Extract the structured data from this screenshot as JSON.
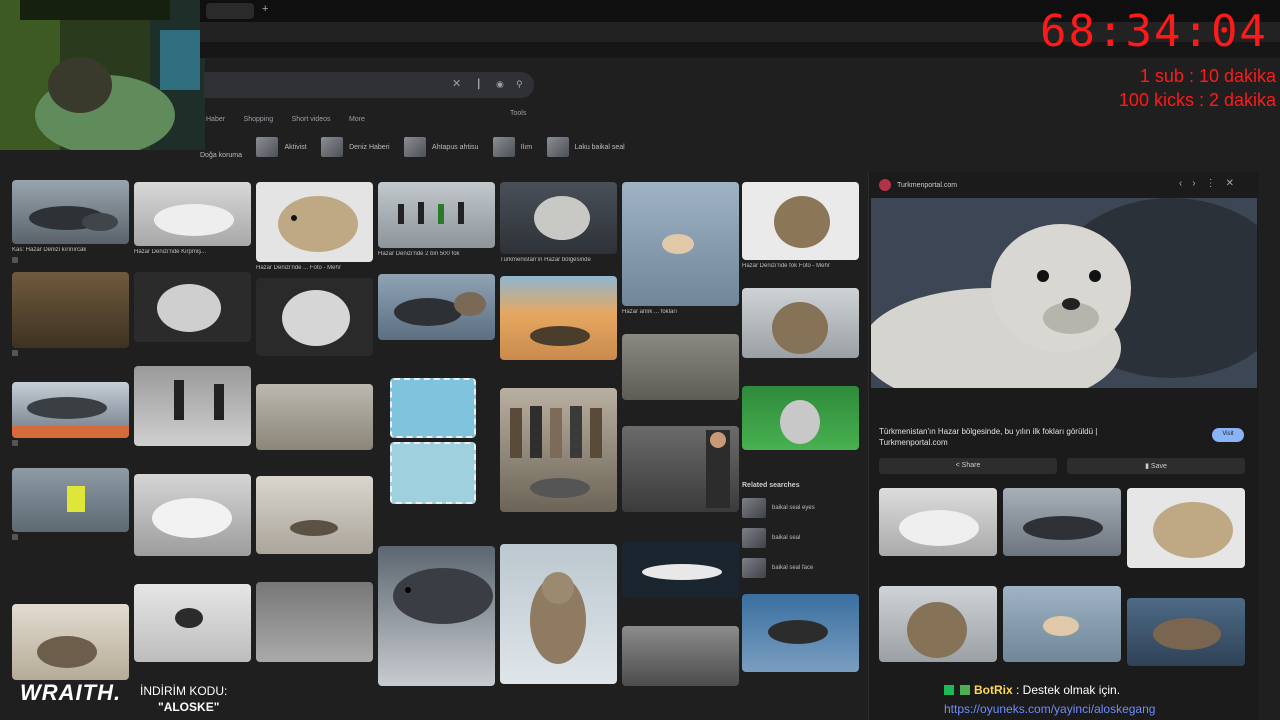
{
  "browser": {
    "tab_label": "",
    "new_tab": "+"
  },
  "search": {
    "clear_icon": "close-icon",
    "filters": [
      "Haber",
      "Shopping",
      "Short videos",
      "More"
    ],
    "tools_label": "Tools"
  },
  "chips": [
    "Doğa koruma",
    "Aktivist",
    "Deniz Haberi",
    "Ahtapus ahtisu",
    "Ilım",
    "Laku baikal seal"
  ],
  "results": [
    {
      "cap": "Kas: Hazar Denizi kırınırcak",
      "src": ""
    },
    {
      "cap": "Hazar Denizi'nde Kirpmiş...",
      "src": ""
    },
    {
      "cap": "Hazar Denizi'nde ... Foto - Mehr",
      "src": ""
    },
    {
      "cap": "Hazar Denizi'nde 2 bin 500 fok",
      "src": ""
    },
    {
      "cap": "Türkmenistan'ın Hazar bölgesinde",
      "src": ""
    },
    {
      "cap": "Hazar anlık ... fokları",
      "src": ""
    },
    {
      "cap": "Hazar Denizi'nde fok Foto - Mehr",
      "src": ""
    }
  ],
  "related": {
    "title": "Related searches",
    "items": [
      "baikal seal eyes",
      "baikal seal",
      "baikal seal face"
    ]
  },
  "panel": {
    "source": "Turkmenportal.com",
    "title": "Türkmenistan'ın Hazar bölgesinde, bu yılın ilk fokları görüldü | Turkmenportal.com",
    "visit": "Visit",
    "share": "Share",
    "save": "Save"
  },
  "overlay": {
    "timer": "68:34:04",
    "rule1": "1 sub : 10 dakika",
    "rule2": "100 kicks : 2 dakika",
    "brand": "WRAITH.",
    "promo1": "İNDİRİM KODU:",
    "promo2": "\"ALOSKE\"",
    "bot_name": "BotRix",
    "bot_msg": ": Destek olmak için.",
    "bot_link": "https://oyuneks.com/yayinci/aloskegang"
  },
  "colors": {
    "timer": "#ff1a1a",
    "bg": "#1f1f1f",
    "accent": "#8ab4f8"
  }
}
